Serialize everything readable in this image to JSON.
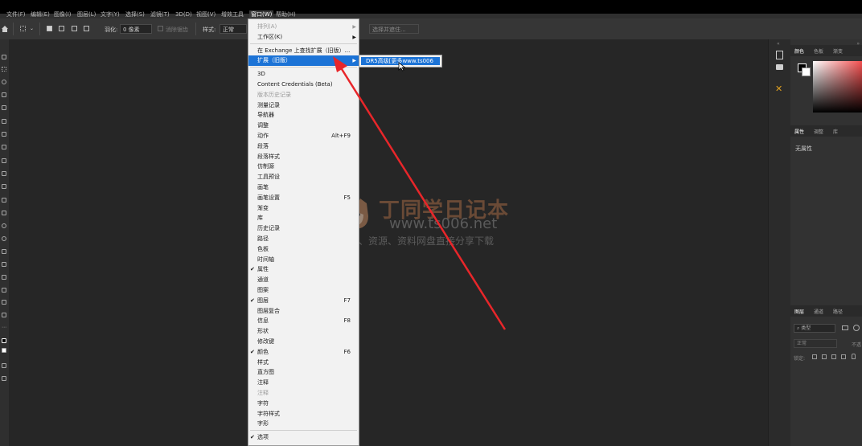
{
  "menubar": {
    "items": [
      "文件(F)",
      "编辑(E)",
      "图像(I)",
      "图层(L)",
      "文字(Y)",
      "选择(S)",
      "滤镜(T)",
      "3D(D)",
      "视图(V)",
      "增效工具",
      "窗口(W)",
      "帮助(H)"
    ],
    "active": "窗口(W)"
  },
  "options": {
    "feather_label": "羽化:",
    "feather_value": "0 像素",
    "antialias_label": "消除锯齿",
    "style_label": "样式:",
    "style_value": "正常",
    "select_mask_label": "选择并遮住..."
  },
  "menu": {
    "items": [
      {
        "label": "排列(A)",
        "arrow": true,
        "disabled": true
      },
      {
        "label": "工作区(K)",
        "arrow": true
      },
      {
        "sep": true
      },
      {
        "label": "在 Exchange 上查找扩展（旧版）..."
      },
      {
        "label": "扩展（旧版）",
        "arrow": true,
        "highlighted": true
      },
      {
        "sep": true
      },
      {
        "label": "3D"
      },
      {
        "label": "Content Credentials (Beta)"
      },
      {
        "label": "版本历史记录",
        "disabled": true
      },
      {
        "label": "测量记录"
      },
      {
        "label": "导航器"
      },
      {
        "label": "调整"
      },
      {
        "label": "动作",
        "shortcut": "Alt+F9"
      },
      {
        "label": "段落"
      },
      {
        "label": "段落样式"
      },
      {
        "label": "仿制源"
      },
      {
        "label": "工具预设"
      },
      {
        "label": "画笔"
      },
      {
        "label": "画笔设置",
        "shortcut": "F5"
      },
      {
        "label": "渐变"
      },
      {
        "label": "库"
      },
      {
        "label": "历史记录"
      },
      {
        "label": "路径"
      },
      {
        "label": "色板"
      },
      {
        "label": "时间轴"
      },
      {
        "label": "属性",
        "checked": true
      },
      {
        "label": "通道"
      },
      {
        "label": "图案"
      },
      {
        "label": "图层",
        "checked": true,
        "shortcut": "F7"
      },
      {
        "label": "图层复合"
      },
      {
        "label": "信息",
        "shortcut": "F8"
      },
      {
        "label": "形状"
      },
      {
        "label": "修改键"
      },
      {
        "label": "颜色",
        "checked": true,
        "shortcut": "F6"
      },
      {
        "label": "样式"
      },
      {
        "label": "直方图"
      },
      {
        "label": "注释"
      },
      {
        "label": "注释",
        "disabled": true
      },
      {
        "label": "字符"
      },
      {
        "label": "字符样式"
      },
      {
        "label": "字形"
      },
      {
        "sep": true
      },
      {
        "label": "选项",
        "checked": true
      }
    ]
  },
  "submenu": {
    "item": "DR5高级[更多www.ts006"
  },
  "panels": {
    "color_tabs": [
      "颜色",
      "色板",
      "渐变"
    ],
    "props_tabs": [
      "属性",
      "调整",
      "库"
    ],
    "props_empty": "无属性",
    "layers_tabs": [
      "图层",
      "通道",
      "路径"
    ],
    "layers_search": "类型",
    "blend_mode": "正常",
    "opacity_label": "不透",
    "lock_label": "锁定:"
  },
  "watermark": {
    "title": "丁同学日记本",
    "url": "www.ts006.net",
    "subtitle": "软件、资源、资料网盘直接分享下载"
  },
  "colors": {
    "highlight": "#1c73d6",
    "arrow": "#e8262a",
    "menu_bg": "#f2f2f2"
  }
}
